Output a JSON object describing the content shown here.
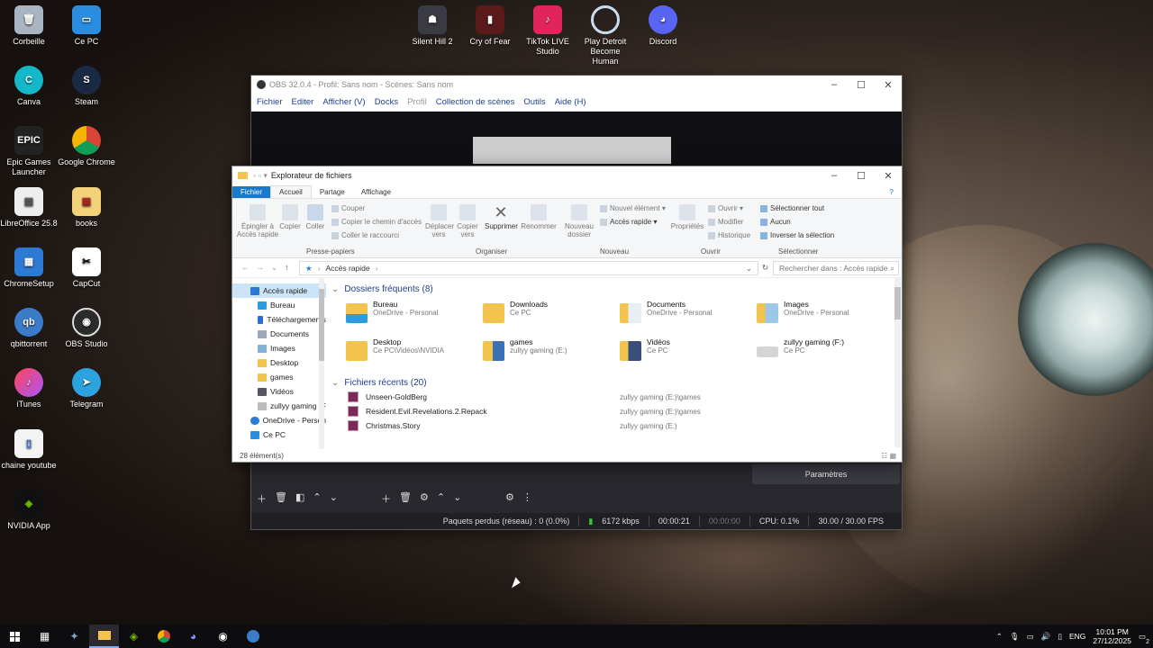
{
  "desktop": {
    "icons": [
      {
        "label": "Corbeille",
        "icon": "recycle-bin-icon"
      },
      {
        "label": "Ce PC",
        "icon": "computer-icon"
      },
      {
        "label": "Canva",
        "icon": "canva-icon"
      },
      {
        "label": "Steam",
        "icon": "steam-icon"
      },
      {
        "label": "Epic Games Launcher",
        "icon": "epic-games-icon"
      },
      {
        "label": "Google Chrome",
        "icon": "chrome-icon"
      },
      {
        "label": "LibreOffice 25.8",
        "icon": "libreoffice-icon"
      },
      {
        "label": "books",
        "icon": "books-icon"
      },
      {
        "label": "ChromeSetup",
        "icon": "installer-icon"
      },
      {
        "label": "CapCut",
        "icon": "capcut-icon"
      },
      {
        "label": "qbittorrent",
        "icon": "qbittorrent-icon"
      },
      {
        "label": "OBS Studio",
        "icon": "obs-icon"
      },
      {
        "label": "iTunes",
        "icon": "itunes-icon"
      },
      {
        "label": "Telegram",
        "icon": "telegram-icon"
      },
      {
        "label": "chaine youtube",
        "icon": "document-icon"
      },
      {
        "label": "NVIDIA App",
        "icon": "nvidia-icon"
      },
      {
        "label": "Silent Hill 2",
        "icon": "game-icon"
      },
      {
        "label": "Cry of Fear",
        "icon": "game-icon"
      },
      {
        "label": "TikTok LIVE Studio",
        "icon": "tiktok-icon"
      },
      {
        "label": "Play Detroit Become Human",
        "icon": "game-icon"
      },
      {
        "label": "Discord",
        "icon": "discord-icon"
      }
    ]
  },
  "obs": {
    "title": "OBS 32.0.4 - Profil: Sans nom - Scènes: Sans nom",
    "menu": [
      "Fichier",
      "Editer",
      "Afficher (V)",
      "Docks",
      "Profil",
      "Collection de scènes",
      "Outils",
      "Aide (H)"
    ],
    "params_button": "Paramètres",
    "status": {
      "dropped": "Paquets perdus (réseau) : 0 (0.0%)",
      "bitrate": "6172 kbps",
      "stream_time": "00:00:21",
      "rec_time": "00:00:00",
      "cpu": "CPU: 0.1%",
      "fps": "30.00 / 30.00 FPS"
    }
  },
  "explorer": {
    "title": "Explorateur de fichiers",
    "tabs": [
      "Fichier",
      "Accueil",
      "Partage",
      "Affichage"
    ],
    "ribbon": {
      "pin": "Épingler à Accès rapide",
      "copy": "Copier",
      "paste": "Coller",
      "cut": "Couper",
      "copy_path": "Copier le chemin d'accès",
      "paste_shortcut": "Coller le raccourci",
      "group_clipboard": "Presse-papiers",
      "move_to": "Déplacer vers",
      "copy_to": "Copier vers",
      "delete": "Supprimer",
      "rename": "Renommer",
      "group_organize": "Organiser",
      "new_folder": "Nouveau dossier",
      "new_item": "Nouvel élément",
      "easy_access": "Accès rapide",
      "group_new": "Nouveau",
      "properties": "Propriétés",
      "open": "Ouvrir",
      "edit": "Modifier",
      "history": "Historique",
      "group_open": "Ouvrir",
      "select_all": "Sélectionner tout",
      "select_none": "Aucun",
      "invert": "Inverser la sélection",
      "group_select": "Sélectionner"
    },
    "address": "Accès rapide",
    "search_placeholder": "Rechercher dans : Accès rapide",
    "nav": [
      "Accès rapide",
      "Bureau",
      "Téléchargements",
      "Documents",
      "Images",
      "Desktop",
      "games",
      "Vidéos",
      "zullyy gaming (F",
      "OneDrive - Person",
      "Ce PC"
    ],
    "frequent_header": "Dossiers fréquents (8)",
    "frequent": [
      {
        "name": "Bureau",
        "loc": "OneDrive - Personal"
      },
      {
        "name": "Downloads",
        "loc": "Ce PC"
      },
      {
        "name": "Documents",
        "loc": "OneDrive - Personal"
      },
      {
        "name": "Images",
        "loc": "OneDrive - Personal"
      },
      {
        "name": "Desktop",
        "loc": "Ce PC\\Vidéos\\NVIDIA"
      },
      {
        "name": "games",
        "loc": "zullyy gaming (E:)"
      },
      {
        "name": "Vidéos",
        "loc": "Ce PC"
      },
      {
        "name": "zullyy gaming (F:)",
        "loc": "Ce PC"
      }
    ],
    "recent_header": "Fichiers récents (20)",
    "recent": [
      {
        "name": "Unseen-GoldBerg",
        "path": "zullyy gaming (E:)\\games"
      },
      {
        "name": "Resident.Evil.Revelations.2.Repack",
        "path": "zullyy gaming (E:)\\games"
      },
      {
        "name": "Christmas.Story",
        "path": "zullyy gaming (E:)"
      }
    ],
    "status": "28 élément(s)"
  },
  "taskbar": {
    "lang": "ENG",
    "time": "10:01 PM",
    "date": "27/12/2025",
    "notif_count": "2"
  },
  "colors": {
    "accent": "#1979ca",
    "obs_bg": "#1e1e23",
    "folder": "#f2c34d"
  }
}
